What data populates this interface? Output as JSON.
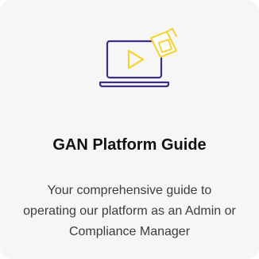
{
  "card": {
    "icon": "laptop-play-graduation-cap-icon",
    "title": "GAN Platform Guide",
    "description_lines": [
      "Your comprehensive guide to",
      "operating our platform as an Admin or",
      "Compliance Manager"
    ]
  },
  "colors": {
    "card_background": "#f6f6f6",
    "icon_outline": "#3b2f86",
    "icon_accent": "#f5d33a"
  }
}
